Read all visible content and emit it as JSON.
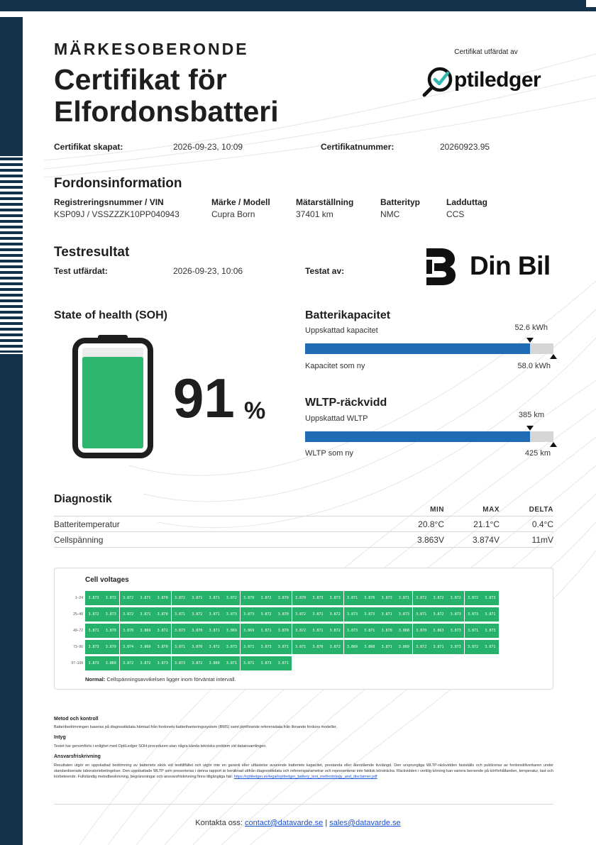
{
  "header": {
    "eyebrow": "MÄRKESOBERONDE",
    "title_line1": "Certifikat för",
    "title_line2": "Elfordonsbatteri",
    "issued_by_label": "Certifikat utfärdat av",
    "issuer_logo": "optiledger"
  },
  "certificate": {
    "created_label": "Certifikat skapat:",
    "created_value": "2026-09-23, 10:09",
    "number_label": "Certifikatnummer:",
    "number_value": "20260923.95"
  },
  "vehicle": {
    "heading": "Fordonsinformation",
    "columns": [
      {
        "label": "Registreringsnummer / VIN",
        "value": "KSP09J / VSSZZZK10PP040943"
      },
      {
        "label": "Märke / Modell",
        "value": "Cupra Born"
      },
      {
        "label": "Mätarställning",
        "value": "37401 km"
      },
      {
        "label": "Batterityp",
        "value": "NMC"
      },
      {
        "label": "Ladduttag",
        "value": "CCS"
      }
    ]
  },
  "test": {
    "heading": "Testresultat",
    "issued_label": "Test utfärdat:",
    "issued_value": "2026-09-23, 10:06",
    "tested_by_label": "Testat av:",
    "tester_logo": "Din Bil"
  },
  "soh": {
    "heading": "State of health (SOH)",
    "value": "91",
    "unit": "%",
    "level": 0.91
  },
  "capacity": {
    "heading": "Batterikapacitet",
    "estimated_label": "Uppskattad kapacitet",
    "estimated_value": "52.6 kWh",
    "new_label": "Kapacitet som ny",
    "new_value": "58.0 kWh",
    "fraction": 0.907
  },
  "range": {
    "heading": "WLTP-räckvidd",
    "estimated_label": "Uppskattad WLTP",
    "estimated_value": "385 km",
    "new_label": "WLTP som ny",
    "new_value": "425 km",
    "fraction": 0.906
  },
  "diagnostics": {
    "heading": "Diagnostik",
    "columns": [
      "MIN",
      "MAX",
      "DELTA"
    ],
    "rows": [
      {
        "name": "Batteritemperatur",
        "min": "20.8°C",
        "max": "21.1°C",
        "delta": "0.4°C"
      },
      {
        "name": "Cellspänning",
        "min": "3.863V",
        "max": "3.874V",
        "delta": "11mV"
      }
    ]
  },
  "cells": {
    "title": "Cell voltages",
    "rows": [
      {
        "label": "1–24",
        "values": [
          "3.873",
          "3.872",
          "3.872",
          "3.871",
          "3.870",
          "3.872",
          "3.871",
          "3.871",
          "3.872",
          "3.870",
          "3.872",
          "3.870",
          "3.870",
          "3.873",
          "3.873",
          "3.871",
          "3.870",
          "3.873",
          "3.871",
          "3.872",
          "3.872",
          "3.872",
          "3.872",
          "3.873"
        ]
      },
      {
        "label": "25–48",
        "values": [
          "3.872",
          "3.873",
          "3.872",
          "3.871",
          "3.870",
          "3.871",
          "3.872",
          "3.871",
          "3.873",
          "3.873",
          "3.872",
          "3.870",
          "3.872",
          "3.871",
          "3.872",
          "3.873",
          "3.873",
          "3.871",
          "3.873",
          "3.871",
          "3.872",
          "3.873",
          "3.873",
          "3.871"
        ]
      },
      {
        "label": "49–72",
        "values": [
          "3.871",
          "3.870",
          "3.870",
          "3.869",
          "3.872",
          "3.873",
          "3.870",
          "3.871",
          "3.869",
          "3.869",
          "3.871",
          "3.870",
          "3.872",
          "3.871",
          "3.872",
          "3.873",
          "3.871",
          "3.870",
          "3.868",
          "3.870",
          "3.863",
          "3.873",
          "3.871",
          "3.873"
        ]
      },
      {
        "label": "73–96",
        "values": [
          "3.873",
          "3.870",
          "3.874",
          "3.869",
          "3.870",
          "3.871",
          "3.870",
          "3.872",
          "3.873",
          "3.871",
          "3.873",
          "3.871",
          "3.871",
          "3.870",
          "3.872",
          "3.869",
          "3.868",
          "3.871",
          "3.869",
          "3.872",
          "3.871",
          "3.873",
          "3.872",
          "3.871"
        ]
      },
      {
        "label": "97–108",
        "values": [
          "3.873",
          "3.869",
          "3.872",
          "3.872",
          "3.873",
          "3.873",
          "3.872",
          "3.869",
          "3.871",
          "3.871",
          "3.873",
          "3.871"
        ]
      }
    ],
    "note_bold": "Normal:",
    "note_text": "Cellspänningsavvikelsen ligger inom förväntat intervall."
  },
  "fine_print": {
    "method_heading": "Metod och kontroll",
    "method_text": "Batteribedömningen baseras på diagnostikdata hämtad från fordonets batterihanteringssystem (BMS) samt jämförande referensdata från liknande fordons modeller.",
    "attest_heading": "Intyg",
    "attest_text": "Testet har genomförts i enlighet med OptiLedger SOH-proceduren utan några kända tekniska problem vid datainsamlingen.",
    "disclaimer_heading": "Ansvarsfriskrivning",
    "disclaimer_text": "Resultaten utgör en uppskattad bedömning av batteriets skick vid testtillfället och utgör inte en garanti eller utfästelse avseende batteriets kapacitet, prestanda eller återstående livslängd. Den ursprungliga WLTP-räckvidden fastställs och publiceras av fordonstillverkaren under standardiserade laboratoriebetingelser. Den uppskattade WLTP som presenteras i denna rapport är beräknad utifrån diagnostikdata och referensparametrar och representerar inte faktisk körsträcka. Räckvidden i verklig körning kan variera beroende på körförhållanden, temperatur, last och körbeteende. Fullständig metodbeskrivning, begränsningar och ansvarsfriskrivning finns tillgängliga här:",
    "disclaimer_link": "https://optiledger.se/legal/optiledger_battery_test_methodology_and_disclaimer.pdf"
  },
  "footer": {
    "prefix": "Kontakta oss:",
    "email1": "contact@datavarde.se",
    "separator": "|",
    "email2": "sales@datavarde.se"
  }
}
